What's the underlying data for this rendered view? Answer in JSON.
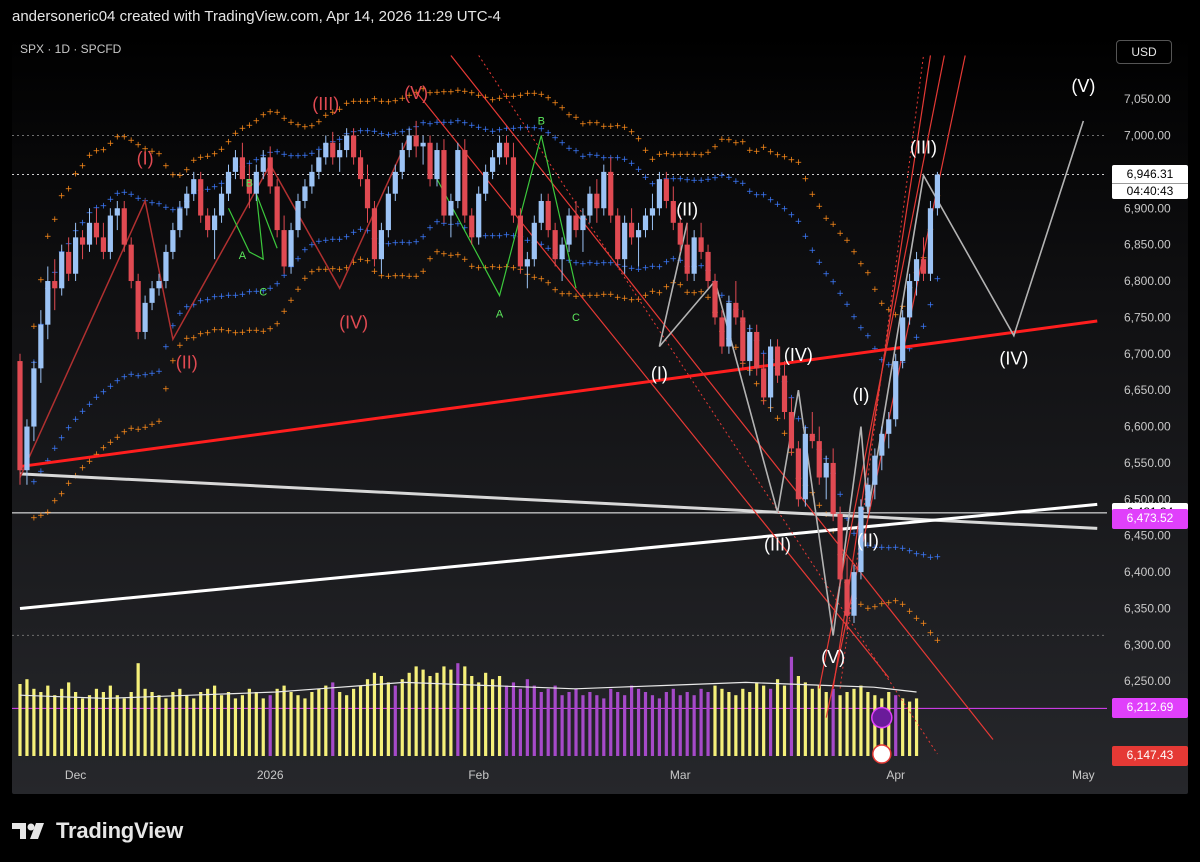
{
  "header": {
    "text": "andersoneric04 created with TradingView.com, Apr 14, 2026 11:29 UTC-4"
  },
  "toolbar": {
    "symbol": "SPX · 1D · SPCFD",
    "currency_button": "USD"
  },
  "footer": {
    "brand": "TradingView"
  },
  "price_boxes": [
    {
      "label": "6,946.31",
      "sub": "04:40:43",
      "price": 6946.31,
      "bg": "#ffffff",
      "fg": "#000000"
    },
    {
      "label": "6,481.34",
      "price": 6481.34,
      "bg": "#ffffff",
      "fg": "#000000"
    },
    {
      "label": "6,473.52",
      "price": 6473.52,
      "bg": "#e040fb",
      "fg": "#ffffff"
    },
    {
      "label": "6,212.69",
      "price": 6212.69,
      "bg": "#e040fb",
      "fg": "#ffffff"
    },
    {
      "label": "6,147.43",
      "price": 6147.43,
      "bg": "#e53935",
      "fg": "#ffffff"
    }
  ],
  "colors": {
    "up": "#9cc3f5",
    "down": "#e04a52",
    "blue_band": "#3d7bff",
    "orange_band": "#ff8c1a",
    "red_line": "#ff1e1e",
    "vol_yellow": "#f5f07a",
    "vol_purple": "#a64ac9",
    "white_line": "#ffffff",
    "grey_line": "#b3b3b3"
  },
  "chart_data": {
    "type": "candlestick",
    "y_axis": {
      "min": 6150,
      "max": 7090,
      "ticks": [
        6250,
        6300,
        6350,
        6400,
        6450,
        6500,
        6550,
        6600,
        6650,
        6700,
        6750,
        6800,
        6850,
        6900,
        6950,
        7000,
        7050
      ]
    },
    "x_axis": {
      "labels": [
        {
          "text": "Dec",
          "idx": 8
        },
        {
          "text": "2026",
          "idx": 36
        },
        {
          "text": "Feb",
          "idx": 66
        },
        {
          "text": "Mar",
          "idx": 95
        },
        {
          "text": "Apr",
          "idx": 126
        },
        {
          "text": "May",
          "idx": 153
        }
      ],
      "num_bars": 172
    },
    "candles": [
      [
        6690,
        6700,
        6520,
        6540
      ],
      [
        6540,
        6610,
        6520,
        6600
      ],
      [
        6600,
        6690,
        6580,
        6680
      ],
      [
        6680,
        6760,
        6660,
        6740
      ],
      [
        6740,
        6820,
        6720,
        6800
      ],
      [
        6800,
        6830,
        6760,
        6790
      ],
      [
        6790,
        6850,
        6780,
        6840
      ],
      [
        6840,
        6860,
        6800,
        6810
      ],
      [
        6810,
        6880,
        6800,
        6860
      ],
      [
        6860,
        6870,
        6830,
        6850
      ],
      [
        6850,
        6900,
        6840,
        6880
      ],
      [
        6880,
        6900,
        6850,
        6860
      ],
      [
        6860,
        6880,
        6830,
        6840
      ],
      [
        6840,
        6900,
        6830,
        6890
      ],
      [
        6890,
        6910,
        6870,
        6900
      ],
      [
        6900,
        6910,
        6840,
        6850
      ],
      [
        6850,
        6860,
        6790,
        6800
      ],
      [
        6800,
        6810,
        6720,
        6730
      ],
      [
        6730,
        6780,
        6720,
        6770
      ],
      [
        6770,
        6800,
        6760,
        6790
      ],
      [
        6790,
        6810,
        6780,
        6800
      ],
      [
        6800,
        6850,
        6790,
        6840
      ],
      [
        6840,
        6880,
        6830,
        6870
      ],
      [
        6870,
        6910,
        6860,
        6900
      ],
      [
        6900,
        6930,
        6890,
        6920
      ],
      [
        6920,
        6950,
        6910,
        6940
      ],
      [
        6940,
        6950,
        6880,
        6890
      ],
      [
        6890,
        6900,
        6860,
        6870
      ],
      [
        6870,
        6900,
        6830,
        6890
      ],
      [
        6890,
        6930,
        6880,
        6920
      ],
      [
        6920,
        6960,
        6910,
        6950
      ],
      [
        6950,
        6980,
        6940,
        6970
      ],
      [
        6970,
        6990,
        6930,
        6940
      ],
      [
        6940,
        6960,
        6900,
        6920
      ],
      [
        6920,
        6960,
        6910,
        6950
      ],
      [
        6950,
        6980,
        6940,
        6970
      ],
      [
        6970,
        6985,
        6920,
        6930
      ],
      [
        6930,
        6940,
        6860,
        6870
      ],
      [
        6870,
        6890,
        6810,
        6820
      ],
      [
        6820,
        6880,
        6810,
        6870
      ],
      [
        6870,
        6920,
        6860,
        6910
      ],
      [
        6910,
        6940,
        6900,
        6930
      ],
      [
        6930,
        6960,
        6920,
        6950
      ],
      [
        6950,
        6980,
        6940,
        6970
      ],
      [
        6970,
        7000,
        6960,
        6990
      ],
      [
        6990,
        7005,
        6960,
        6970
      ],
      [
        6970,
        6990,
        6950,
        6980
      ],
      [
        6980,
        7010,
        6970,
        7000
      ],
      [
        7000,
        7010,
        6960,
        6970
      ],
      [
        6970,
        6980,
        6930,
        6940
      ],
      [
        6940,
        6960,
        6880,
        6900
      ],
      [
        6900,
        6910,
        6820,
        6830
      ],
      [
        6830,
        6880,
        6810,
        6870
      ],
      [
        6870,
        6930,
        6860,
        6920
      ],
      [
        6920,
        6960,
        6910,
        6950
      ],
      [
        6950,
        6990,
        6940,
        6980
      ],
      [
        6980,
        7010,
        6970,
        7000
      ],
      [
        7000,
        7020,
        6970,
        6985
      ],
      [
        6985,
        7000,
        6960,
        6990
      ],
      [
        6990,
        7000,
        6930,
        6940
      ],
      [
        6940,
        6990,
        6930,
        6980
      ],
      [
        6980,
        6995,
        6880,
        6890
      ],
      [
        6890,
        6920,
        6860,
        6910
      ],
      [
        6910,
        6990,
        6900,
        6980
      ],
      [
        6980,
        6995,
        6880,
        6890
      ],
      [
        6890,
        6900,
        6850,
        6860
      ],
      [
        6860,
        6930,
        6850,
        6920
      ],
      [
        6920,
        6960,
        6910,
        6950
      ],
      [
        6950,
        6980,
        6940,
        6970
      ],
      [
        6970,
        7000,
        6960,
        6990
      ],
      [
        6990,
        7000,
        6960,
        6970
      ],
      [
        6970,
        6990,
        6880,
        6890
      ],
      [
        6890,
        6900,
        6810,
        6820
      ],
      [
        6820,
        6840,
        6790,
        6830
      ],
      [
        6830,
        6890,
        6820,
        6880
      ],
      [
        6880,
        6920,
        6870,
        6910
      ],
      [
        6910,
        6920,
        6860,
        6870
      ],
      [
        6870,
        6880,
        6820,
        6830
      ],
      [
        6830,
        6860,
        6800,
        6850
      ],
      [
        6850,
        6900,
        6840,
        6890
      ],
      [
        6890,
        6910,
        6860,
        6870
      ],
      [
        6870,
        6900,
        6840,
        6890
      ],
      [
        6890,
        6930,
        6880,
        6920
      ],
      [
        6920,
        6940,
        6880,
        6900
      ],
      [
        6900,
        6960,
        6890,
        6950
      ],
      [
        6950,
        6970,
        6880,
        6890
      ],
      [
        6890,
        6900,
        6820,
        6830
      ],
      [
        6830,
        6890,
        6810,
        6880
      ],
      [
        6880,
        6900,
        6850,
        6860
      ],
      [
        6860,
        6880,
        6820,
        6870
      ],
      [
        6870,
        6900,
        6860,
        6890
      ],
      [
        6890,
        6920,
        6870,
        6900
      ],
      [
        6900,
        6950,
        6890,
        6940
      ],
      [
        6940,
        6950,
        6900,
        6910
      ],
      [
        6910,
        6930,
        6870,
        6880
      ],
      [
        6880,
        6890,
        6840,
        6850
      ],
      [
        6850,
        6880,
        6800,
        6810
      ],
      [
        6810,
        6870,
        6800,
        6860
      ],
      [
        6860,
        6880,
        6830,
        6840
      ],
      [
        6840,
        6850,
        6790,
        6800
      ],
      [
        6800,
        6810,
        6740,
        6750
      ],
      [
        6750,
        6760,
        6700,
        6710
      ],
      [
        6710,
        6780,
        6700,
        6770
      ],
      [
        6770,
        6800,
        6740,
        6750
      ],
      [
        6750,
        6760,
        6680,
        6690
      ],
      [
        6690,
        6740,
        6670,
        6730
      ],
      [
        6730,
        6740,
        6670,
        6680
      ],
      [
        6680,
        6700,
        6630,
        6640
      ],
      [
        6640,
        6720,
        6620,
        6710
      ],
      [
        6710,
        6720,
        6660,
        6670
      ],
      [
        6670,
        6690,
        6610,
        6620
      ],
      [
        6620,
        6640,
        6560,
        6570
      ],
      [
        6570,
        6580,
        6490,
        6500
      ],
      [
        6500,
        6600,
        6490,
        6590
      ],
      [
        6590,
        6620,
        6570,
        6580
      ],
      [
        6580,
        6600,
        6520,
        6530
      ],
      [
        6530,
        6560,
        6500,
        6550
      ],
      [
        6550,
        6570,
        6470,
        6480
      ],
      [
        6480,
        6490,
        6380,
        6390
      ],
      [
        6390,
        6420,
        6320,
        6340
      ],
      [
        6340,
        6410,
        6330,
        6400
      ],
      [
        6400,
        6500,
        6390,
        6490
      ],
      [
        6490,
        6530,
        6480,
        6520
      ],
      [
        6520,
        6570,
        6500,
        6560
      ],
      [
        6560,
        6600,
        6540,
        6590
      ],
      [
        6590,
        6620,
        6570,
        6610
      ],
      [
        6610,
        6700,
        6600,
        6690
      ],
      [
        6690,
        6760,
        6680,
        6750
      ],
      [
        6750,
        6810,
        6740,
        6800
      ],
      [
        6800,
        6840,
        6780,
        6830
      ],
      [
        6830,
        6860,
        6800,
        6810
      ],
      [
        6810,
        6910,
        6800,
        6900
      ],
      [
        6900,
        6950,
        6890,
        6946.31
      ]
    ],
    "volume_pct": [
      0.45,
      0.48,
      0.42,
      0.4,
      0.44,
      0.38,
      0.42,
      0.46,
      0.4,
      0.36,
      0.38,
      0.42,
      0.4,
      0.44,
      0.38,
      0.36,
      0.4,
      0.58,
      0.42,
      0.4,
      0.38,
      0.36,
      0.4,
      0.42,
      0.38,
      0.36,
      0.4,
      0.42,
      0.44,
      0.38,
      0.4,
      0.36,
      0.38,
      0.42,
      0.4,
      0.36,
      0.38,
      0.42,
      0.44,
      0.4,
      0.38,
      0.36,
      0.4,
      0.42,
      0.44,
      0.46,
      0.4,
      0.38,
      0.42,
      0.44,
      0.48,
      0.52,
      0.5,
      0.46,
      0.44,
      0.48,
      0.52,
      0.56,
      0.54,
      0.5,
      0.52,
      0.56,
      0.54,
      0.58,
      0.56,
      0.5,
      0.46,
      0.52,
      0.48,
      0.5,
      0.44,
      0.46,
      0.42,
      0.48,
      0.44,
      0.4,
      0.42,
      0.44,
      0.38,
      0.4,
      0.42,
      0.38,
      0.4,
      0.38,
      0.36,
      0.42,
      0.4,
      0.38,
      0.44,
      0.42,
      0.4,
      0.38,
      0.36,
      0.4,
      0.42,
      0.38,
      0.4,
      0.38,
      0.42,
      0.4,
      0.44,
      0.42,
      0.4,
      0.38,
      0.42,
      0.4,
      0.46,
      0.44,
      0.42,
      0.48,
      0.44,
      0.62,
      0.5,
      0.46,
      0.42,
      0.44,
      0.4,
      0.42,
      0.38,
      0.4,
      0.42,
      0.44,
      0.4,
      0.38,
      0.36,
      0.4,
      0.38,
      0.36,
      0.34,
      0.36
    ],
    "volume_ma": [
      0.38,
      0.37,
      0.36,
      0.37,
      0.38,
      0.39,
      0.4,
      0.42,
      0.44,
      0.46,
      0.45,
      0.44,
      0.43,
      0.42,
      0.43,
      0.44,
      0.45,
      0.46,
      0.45,
      0.44,
      0.43,
      0.4
    ],
    "wave_labels": [
      {
        "text": "(I)",
        "idx": 18,
        "price": 6960,
        "color": "#e04a52"
      },
      {
        "text": "(II)",
        "idx": 24,
        "price": 6680,
        "color": "#e04a52"
      },
      {
        "text": "(III)",
        "idx": 44,
        "price": 7035,
        "color": "#e04a52"
      },
      {
        "text": "(IV)",
        "idx": 48,
        "price": 6735,
        "color": "#e04a52"
      },
      {
        "text": "(V)",
        "idx": 57,
        "price": 7050,
        "color": "#e04a52"
      },
      {
        "text": "(II)",
        "idx": 96,
        "price": 6890,
        "color": "#ffffff"
      },
      {
        "text": "(I)",
        "idx": 92,
        "price": 6665,
        "color": "#ffffff"
      },
      {
        "text": "(IV)",
        "idx": 112,
        "price": 6690,
        "color": "#ffffff"
      },
      {
        "text": "(III)",
        "idx": 109,
        "price": 6430,
        "color": "#ffffff"
      },
      {
        "text": "(V)",
        "idx": 117,
        "price": 6275,
        "color": "#ffffff"
      },
      {
        "text": "(I)",
        "idx": 121,
        "price": 6635,
        "color": "#ffffff"
      },
      {
        "text": "(II)",
        "idx": 122,
        "price": 6435,
        "color": "#ffffff"
      },
      {
        "text": "(III)",
        "idx": 130,
        "price": 6975,
        "color": "#ffffff"
      },
      {
        "text": "(IV)",
        "idx": 143,
        "price": 6685,
        "color": "#ffffff"
      },
      {
        "text": "(V)",
        "idx": 153,
        "price": 7060,
        "color": "#ffffff"
      },
      {
        "text": "B",
        "idx": 33,
        "price": 6930,
        "color": "#5ce65c"
      },
      {
        "text": "A",
        "idx": 32,
        "price": 6830,
        "color": "#5ce65c"
      },
      {
        "text": "C",
        "idx": 35,
        "price": 6780,
        "color": "#5ce65c"
      },
      {
        "text": "B",
        "idx": 75,
        "price": 7015,
        "color": "#5ce65c"
      },
      {
        "text": "A",
        "idx": 69,
        "price": 6750,
        "color": "#5ce65c"
      },
      {
        "text": "C",
        "idx": 80,
        "price": 6745,
        "color": "#5ce65c"
      }
    ]
  }
}
